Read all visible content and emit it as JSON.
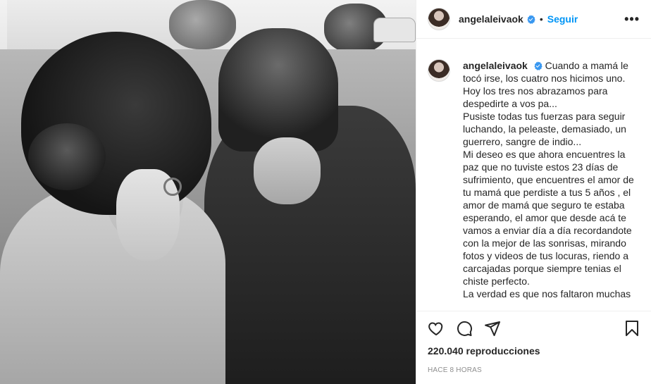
{
  "post": {
    "media": {
      "type": "video",
      "alt": "black and white photo"
    },
    "author": {
      "username": "angelaleivaok",
      "verified": true,
      "follow_label": "Seguir",
      "separator": "•",
      "more_label": "•••"
    },
    "caption": {
      "username": "angelaleivaok",
      "paragraphs": [
        "Cuando a mamá le tocó irse, los cuatro nos hicimos uno. Hoy los tres nos abrazamos para despedirte a vos pa...",
        "Pusiste todas tus fuerzas para seguir luchando, la peleaste, demasiado, un guerrero, sangre de indio...",
        "Mi deseo es que ahora encuentres la paz que no tuviste estos 23 días de sufrimiento, que encuentres el amor de tu mamá que perdiste a tus 5 años , el amor de mamá que seguro te estaba esperando, el amor que desde acá te vamos a enviar día a día recordandote con la mejor de las sonrisas, mirando fotos y videos de tus locuras, riendo a carcajadas porque siempre tenias el chiste perfecto.",
        "La verdad es que nos faltaron muchas"
      ]
    },
    "actions": {
      "icons": [
        "heart-icon",
        "comment-icon",
        "share-icon",
        "bookmark-icon"
      ],
      "views": "220.040 reproducciones",
      "timestamp": "HACE 8 HORAS"
    },
    "colors": {
      "accent": "#0095f6",
      "text": "#262626",
      "muted": "#8e8e8e",
      "border": "#efefef",
      "verified": "#3897f0"
    }
  }
}
